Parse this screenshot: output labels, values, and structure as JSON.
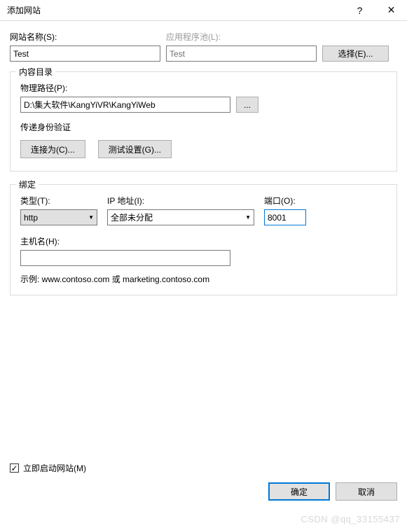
{
  "titlebar": {
    "title": "添加网站",
    "help": "?",
    "close": "×"
  },
  "site": {
    "name_label": "网站名称(S):",
    "name_value": "Test",
    "pool_label": "应用程序池(L):",
    "pool_value": "Test",
    "select_btn": "选择(E)..."
  },
  "content_dir": {
    "legend": "内容目录",
    "path_label": "物理路径(P):",
    "path_value": "D:\\集大软件\\KangYiVR\\KangYiWeb",
    "browse_btn": "...",
    "auth_label": "传递身份验证",
    "connect_btn": "连接为(C)...",
    "test_btn": "测试设置(G)..."
  },
  "binding": {
    "legend": "绑定",
    "type_label": "类型(T):",
    "type_value": "http",
    "ip_label": "IP 地址(I):",
    "ip_value": "全部未分配",
    "port_label": "端口(O):",
    "port_value": "8001",
    "host_label": "主机名(H):",
    "host_value": "",
    "example": "示例: www.contoso.com 或 marketing.contoso.com"
  },
  "start_site": {
    "label": "立即启动网站(M)",
    "checked": "✓"
  },
  "footer": {
    "ok": "确定",
    "cancel": "取消"
  },
  "watermark": "CSDN @qq_33155437"
}
